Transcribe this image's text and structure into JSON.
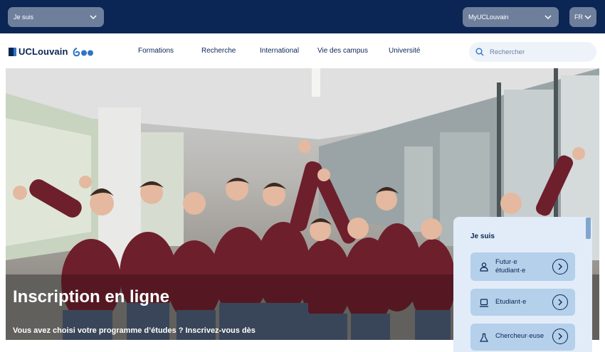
{
  "topbar": {
    "audience_select": "Je suis",
    "portal_select": "MyUCLouvain",
    "language": "FR"
  },
  "brand": {
    "name": "UCLouvain",
    "anniversary": "600",
    "color_primary": "#0b2554",
    "color_accent": "#2f74c8"
  },
  "nav": {
    "items": [
      "Formations",
      "Recherche",
      "International",
      "Vie des campus",
      "Université"
    ]
  },
  "search": {
    "placeholder": "Rechercher"
  },
  "hero": {
    "title": "Inscription en ligne",
    "subtitle": "Vous avez choisi votre programme d’études ? Inscrivez-vous dès"
  },
  "profile_card": {
    "title": "Je suis",
    "options": [
      {
        "line1": "Futur·e",
        "line2": "étudiant·e",
        "icon": "person-icon"
      },
      {
        "line1": "Etudiant·e",
        "line2": "",
        "icon": "laptop-icon"
      },
      {
        "line1": "Chercheur·euse",
        "line2": "",
        "icon": "flask-icon"
      }
    ]
  }
}
